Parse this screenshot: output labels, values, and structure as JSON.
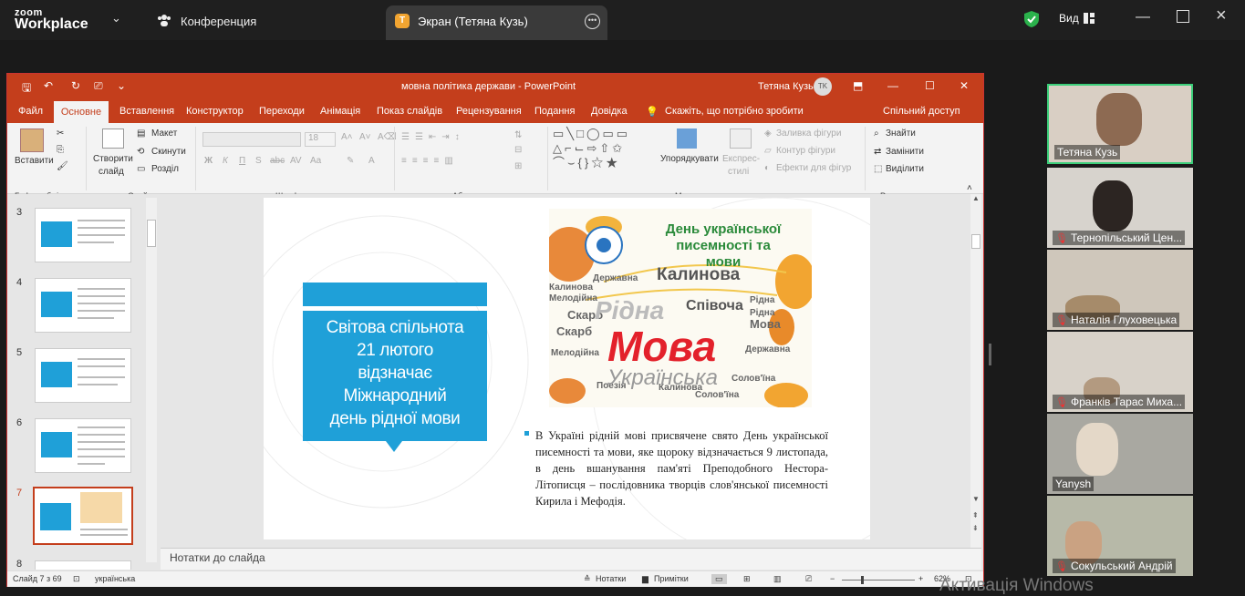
{
  "zoom": {
    "logo_top": "zoom",
    "logo_bottom": "Workplace",
    "conference": "Конференция",
    "screen_tab": "Экран (Тетяна Кузь)",
    "screen_badge": "T",
    "view": "Вид"
  },
  "ppt": {
    "title": "мовна політика держави  -  PowerPoint",
    "user": "Тетяна Кузь",
    "user_initials": "TK",
    "tabs": [
      "Файл",
      "Основне",
      "Вставлення",
      "Конструктор",
      "Переходи",
      "Анімація",
      "Показ слайдів",
      "Рецензування",
      "Подання",
      "Довідка",
      "Скажіть, що потрібно зробити",
      "Спільний доступ"
    ],
    "ribbon": {
      "paste": "Вставити",
      "clipboard": "Буфер обміну",
      "new_slide_1": "Створити",
      "new_slide_2": "слайд",
      "layout": "Макет",
      "reset": "Скинути",
      "section": "Розділ",
      "slides": "Слайди",
      "font_size": "18",
      "font": "Шрифт",
      "paragraph": "Абзац",
      "arrange": "Упорядкувати",
      "quick_1": "Експрес-",
      "quick_2": "стилі",
      "fill": "Заливка фігури",
      "outline": "Контур фігури",
      "effects": "Ефекти для фігур",
      "drawing": "Малювання",
      "find": "Знайти",
      "replace": "Замінити",
      "select": "Виділити",
      "editing": "Редагування"
    },
    "thumbs": [
      {
        "n": "3"
      },
      {
        "n": "4"
      },
      {
        "n": "5"
      },
      {
        "n": "6"
      },
      {
        "n": "7"
      },
      {
        "n": "8"
      }
    ],
    "slide": {
      "box_text": [
        "Світова спільнота",
        "21 лютого",
        "відзначає",
        "Міжнародний",
        "день рідної мови"
      ],
      "poster_title_1": "День української",
      "poster_title_2": "писемності та",
      "poster_title_3": "мови",
      "poster_mova": "Мова",
      "poster_ukr": "Українська",
      "poster_ridna": "Рідна",
      "poster_words": [
        "Державна",
        "Калинова",
        "Співоча",
        "Скарб",
        "Мелодійна",
        "Солов'їна",
        "Рідна",
        "Мова",
        "Калинова",
        "Поезія",
        "Скарб",
        "Державна",
        "Калинова",
        "Мелодійна",
        "Рідна",
        "Солов'їна"
      ],
      "body": "В Україні рідній мові присвячене свято День української писемності та мови, яке щороку відзначається 9 листопада, в день вшанування пам'яті Преподобного Нестора-Літописця – послідовника творців слов'янської писемності Кирила і Мефодія."
    },
    "notes": "Нотатки до слайда",
    "status": {
      "slide": "Слайд 7 з 69",
      "lang": "українська",
      "notes": "Нотатки",
      "comments": "Примітки",
      "zoom": "62%"
    }
  },
  "participants": [
    {
      "name": "Тетяна Кузь",
      "muted": false
    },
    {
      "name": "Тернопільський Цен...",
      "muted": true
    },
    {
      "name": "Наталія Глуховецька",
      "muted": true
    },
    {
      "name": "Франків Тарас Миха...",
      "muted": true
    },
    {
      "name": "Yanysh",
      "muted": false
    },
    {
      "name": "Сокульський Андрій",
      "muted": true
    }
  ],
  "watermark": "Активація Windows",
  "colors": {
    "ppt_accent": "#c43e1c",
    "slide_blue": "#1fa0d8",
    "active_speaker": "#3ccf7a"
  }
}
